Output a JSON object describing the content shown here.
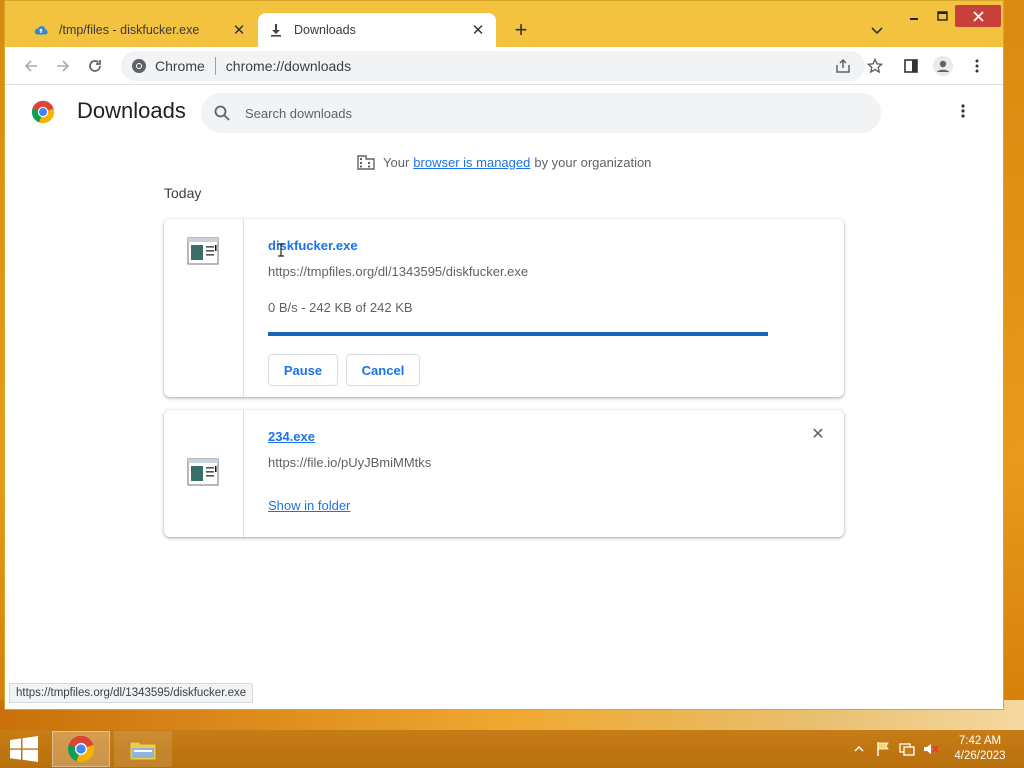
{
  "tabs": [
    {
      "title": "/tmp/files - diskfucker.exe",
      "icon": "cloud-upload-icon",
      "active": false
    },
    {
      "title": "Downloads",
      "icon": "download-icon",
      "active": true
    }
  ],
  "omnibox": {
    "scheme_label": "Chrome",
    "url": "chrome://downloads"
  },
  "page": {
    "title": "Downloads",
    "search_placeholder": "Search downloads",
    "managed_prefix": "Your",
    "managed_link": "browser is managed",
    "managed_suffix": "by your organization",
    "section_label": "Today"
  },
  "downloads": [
    {
      "filename": "diskfucker.exe",
      "url": "https://tmpfiles.org/dl/1343595/diskfucker.exe",
      "status": "0 B/s - 242 KB of 242 KB",
      "progress": 1.0,
      "pause_label": "Pause",
      "cancel_label": "Cancel"
    },
    {
      "filename": "234.exe",
      "url": "https://file.io/pUyJBmiMMtks",
      "show_in_folder_label": "Show in folder"
    }
  ],
  "status_bubble": "https://tmpfiles.org/dl/1343595/diskfucker.exe",
  "taskbar": {
    "time": "7:42 AM",
    "date": "4/26/2023"
  },
  "colors": {
    "accent": "#1a73e8",
    "frame": "#f3c240",
    "close": "#c7413a"
  }
}
